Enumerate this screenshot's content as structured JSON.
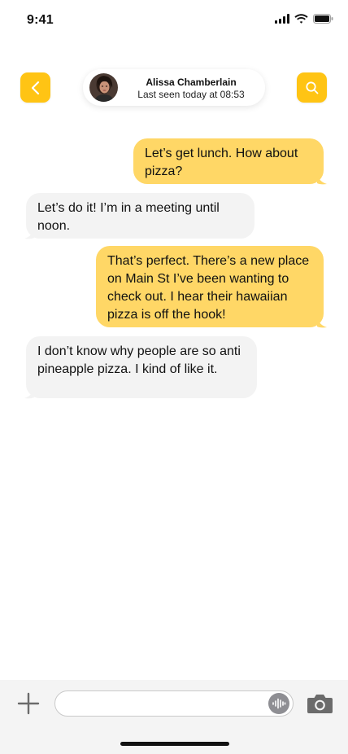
{
  "status_bar": {
    "time": "9:41",
    "icons": [
      "cellular-signal-icon",
      "wifi-icon",
      "battery-icon"
    ]
  },
  "header": {
    "back_icon": "chevron-left-icon",
    "search_icon": "search-icon",
    "contact": {
      "name": "Alissa Chamberlain",
      "status": "Last seen today at 08:53"
    }
  },
  "messages": [
    {
      "sender": "me",
      "text": "Let’s get lunch. How about pizza?"
    },
    {
      "sender": "contact",
      "text": "Let’s do it! I’m in a meeting until noon."
    },
    {
      "sender": "me",
      "text": "That’s perfect. There’s a new place on Main St I’ve been wanting to check out. I hear their hawaiian pizza is off the hook!"
    },
    {
      "sender": "contact",
      "text": "I don’t know why people are so anti pineapple pizza. I kind of like it."
    }
  ],
  "composer": {
    "placeholder": "",
    "value": "",
    "add_icon": "plus-icon",
    "audio_icon": "waveform-icon",
    "camera_icon": "camera-icon"
  },
  "colors": {
    "accent": "#FFC414",
    "sent_bubble": "#FFD766",
    "received_bubble": "#F3F3F3",
    "composer_background": "#F4F4F4"
  }
}
